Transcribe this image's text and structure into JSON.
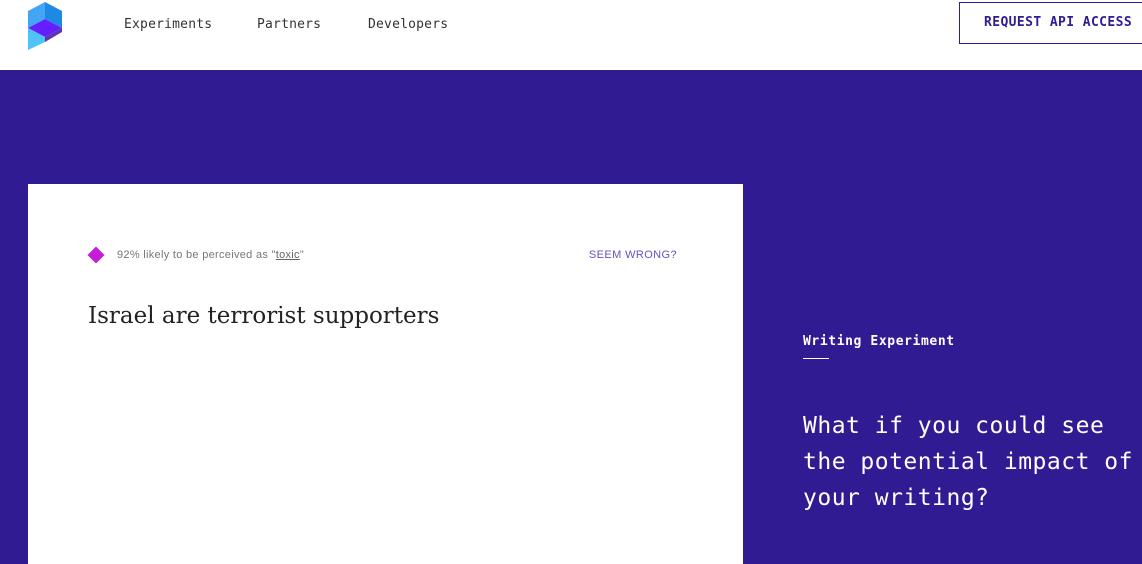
{
  "brand": {
    "logo_icon": "perspective-cube-logo-icon",
    "colors": {
      "primary": "#311b92",
      "accent": "#c51ed9",
      "link": "#6a4fc7"
    }
  },
  "nav": {
    "items": [
      {
        "label": "Experiments"
      },
      {
        "label": "Partners"
      },
      {
        "label": "Developers"
      }
    ],
    "cta_label": "REQUEST API ACCESS"
  },
  "demo": {
    "score": {
      "icon": "diamond-icon",
      "prefix": "92% likely to be perceived as \"",
      "attribute": "toxic",
      "suffix": "\""
    },
    "feedback_label": "SEEM WRONG?",
    "input_value": "Israel are terrorist supporters"
  },
  "aside": {
    "section_label": "Writing Experiment",
    "headline": "What if you could see the potential impact of your writing?"
  }
}
